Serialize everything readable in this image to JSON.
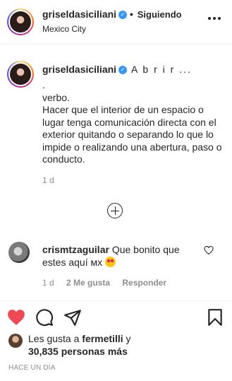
{
  "header": {
    "username": "griseldasiciliani",
    "verified_icon": "verified-badge-icon",
    "separator": "•",
    "follow_label": "Siguiendo",
    "location": "Mexico City",
    "more_icon": "more-options-icon"
  },
  "caption": {
    "username": "griseldasiciliani",
    "title": "A b r i r ...",
    "body": ".\nverbo.\nHacer que el interior de un espacio o lugar tenga comunicación directa con el exterior quitando o separando lo que lo impide o realizando una abertura, paso o conducto.",
    "time": "1 d"
  },
  "load_more_icon": "plus-circle-icon",
  "comment": {
    "username": "crismtzaguilar",
    "text": "Que bonito que estes aquí мх",
    "emoji_icon": "star-struck-emoji-icon",
    "time": "1 d",
    "likes": "2 Me gusta",
    "reply": "Responder",
    "like_icon": "heart-outline-icon"
  },
  "actions": {
    "like_icon": "heart-filled-icon",
    "comment_icon": "comment-icon",
    "share_icon": "paper-plane-icon",
    "save_icon": "bookmark-icon",
    "like_color": "#ed4956"
  },
  "likes": {
    "prefix": "Les gusta a ",
    "user": "fermetilli",
    "connector": " y",
    "count": "30,835 personas más"
  },
  "posted_ago": "HACE UN DÍA"
}
